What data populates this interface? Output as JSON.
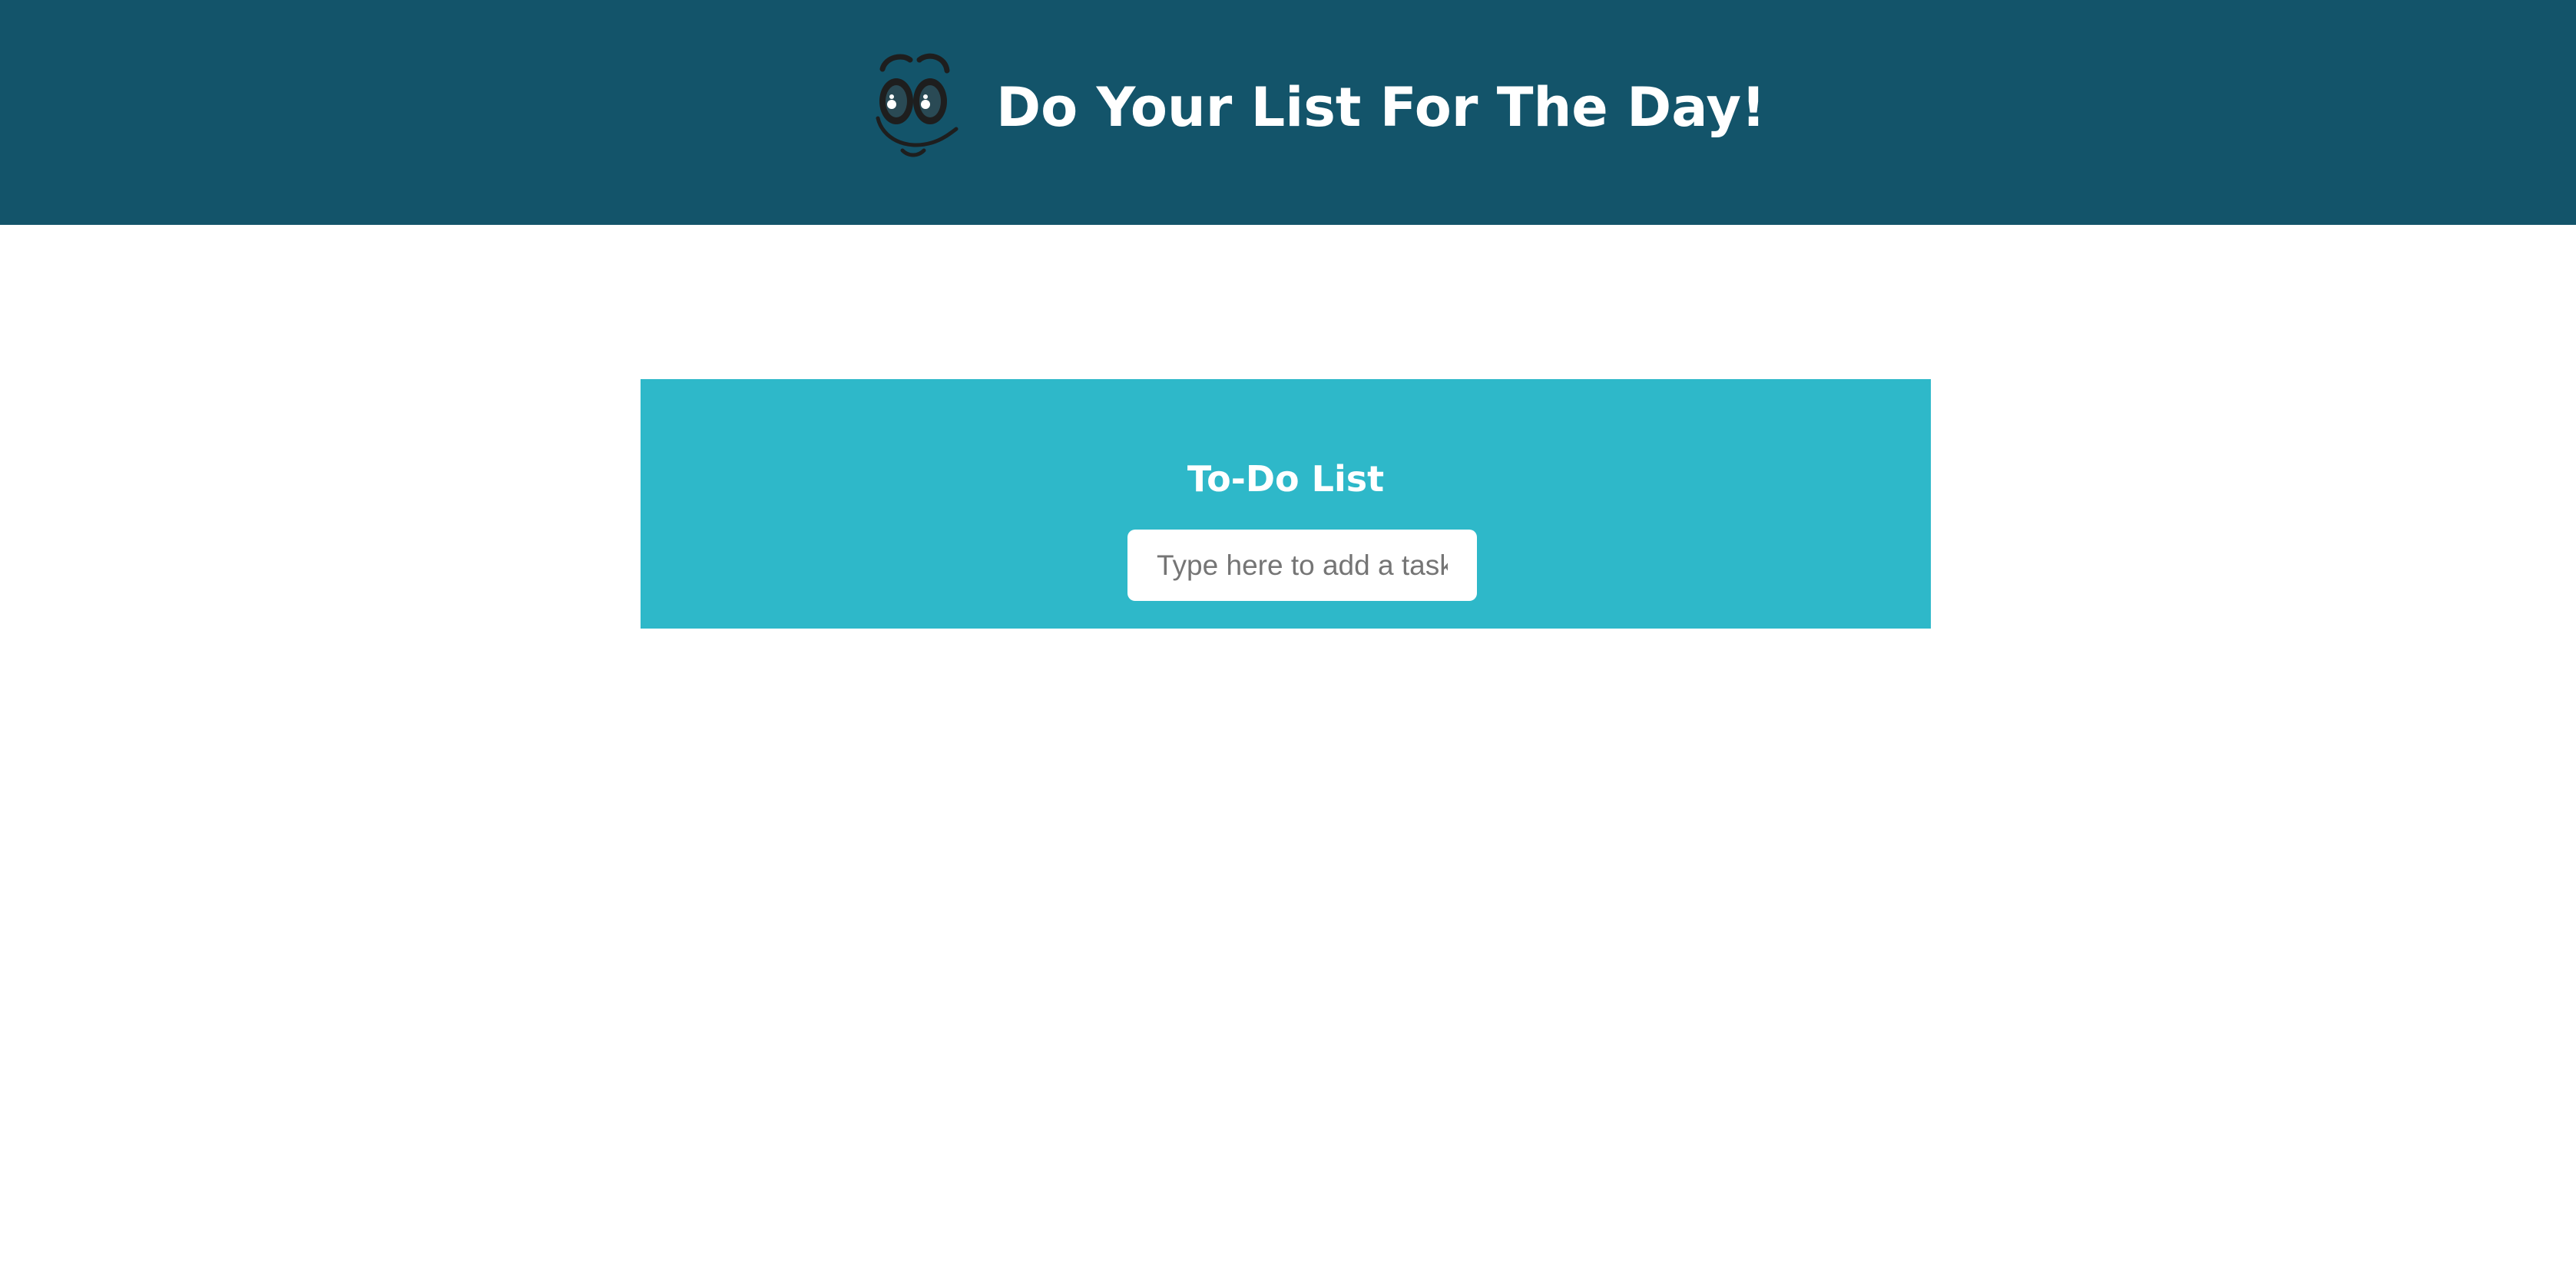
{
  "header": {
    "title": "Do Your List For The Day!",
    "logo_icon": "cartoon-face-icon",
    "background_color": "#13546a"
  },
  "todo": {
    "heading": "To-Do List",
    "input_placeholder": "Type here to add a task",
    "input_value": "",
    "background_color": "#2eb8c9"
  }
}
